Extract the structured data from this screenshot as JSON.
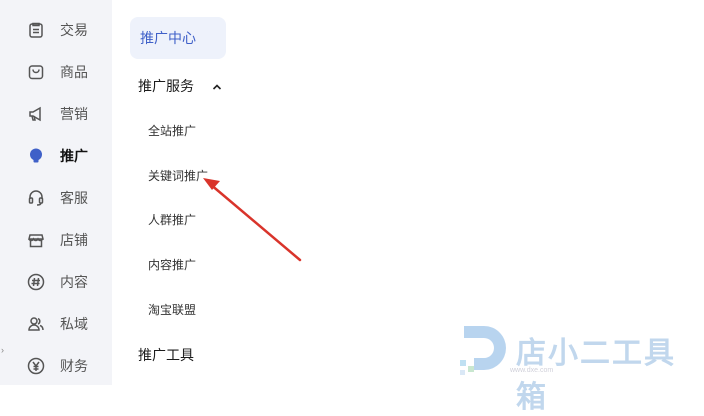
{
  "sidebar": {
    "items": [
      {
        "label": "交易",
        "icon": "clipboard-icon"
      },
      {
        "label": "商品",
        "icon": "shopping-bag-icon"
      },
      {
        "label": "营销",
        "icon": "megaphone-icon"
      },
      {
        "label": "推广",
        "icon": "lightbulb-icon",
        "active": true
      },
      {
        "label": "客服",
        "icon": "headset-icon"
      },
      {
        "label": "店铺",
        "icon": "storefront-icon"
      },
      {
        "label": "内容",
        "icon": "hashtag-icon"
      },
      {
        "label": "私域",
        "icon": "users-icon"
      },
      {
        "label": "财务",
        "icon": "yen-coin-icon"
      }
    ],
    "edge_mark": "›"
  },
  "subnav": {
    "center": "推广中心",
    "service_section": {
      "label": "推广服务",
      "expanded": true
    },
    "service_items": [
      "全站推广",
      "关键词推广",
      "人群推广",
      "内容推广",
      "淘宝联盟"
    ],
    "tools_section": {
      "label": "推广工具"
    }
  },
  "annotation": {
    "arrow_color": "#d9342b",
    "target": "关键词推广"
  },
  "watermark": {
    "text": "店小二工具箱",
    "url": "www.dxe.com"
  },
  "colors": {
    "sidebar_bg": "#f3f4f8",
    "accent": "#3f60c8",
    "pill_bg": "#eef2fb"
  }
}
